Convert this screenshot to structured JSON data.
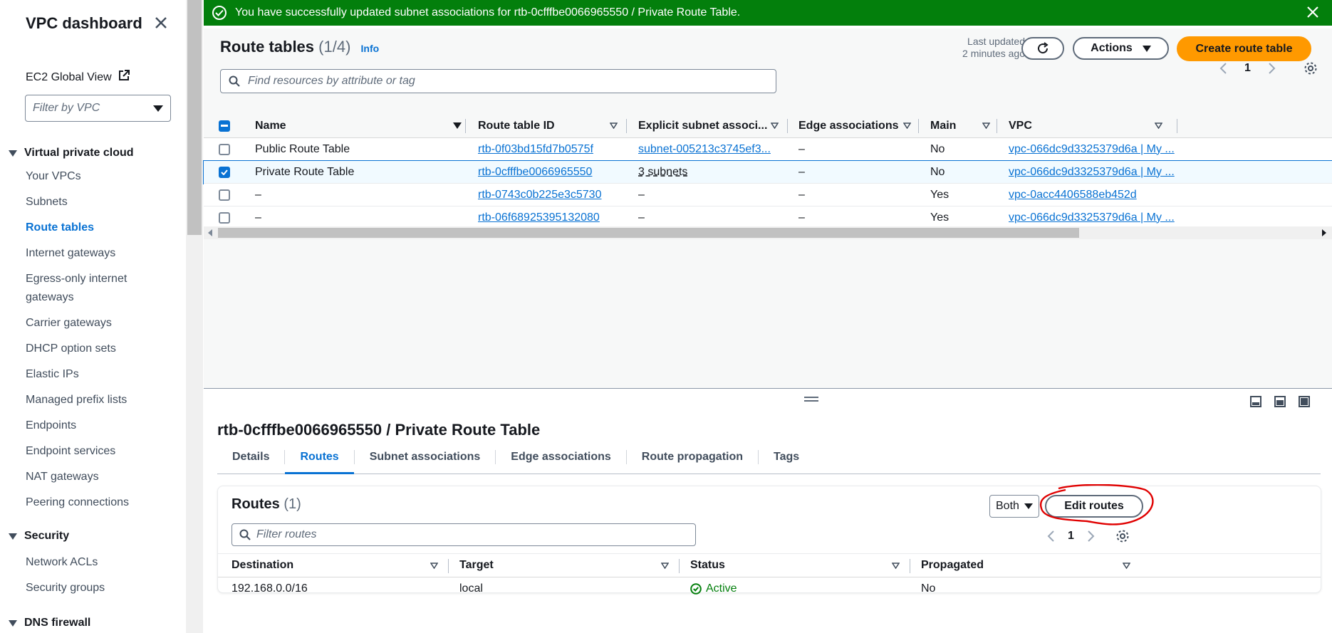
{
  "sidebar": {
    "title": "VPC dashboard",
    "global_view": "EC2 Global View",
    "vpc_filter_placeholder": "Filter by VPC",
    "sections": [
      {
        "label": "Virtual private cloud"
      },
      {
        "label": "Security"
      },
      {
        "label": "DNS firewall"
      }
    ],
    "items": [
      {
        "label": "Your VPCs"
      },
      {
        "label": "Subnets"
      },
      {
        "label": "Route tables"
      },
      {
        "label": "Internet gateways"
      },
      {
        "label": "Egress-only internet gateways"
      },
      {
        "label": "Carrier gateways"
      },
      {
        "label": "DHCP option sets"
      },
      {
        "label": "Elastic IPs"
      },
      {
        "label": "Managed prefix lists"
      },
      {
        "label": "Endpoints"
      },
      {
        "label": "Endpoint services"
      },
      {
        "label": "NAT gateways"
      },
      {
        "label": "Peering connections"
      },
      {
        "label": "Network ACLs"
      },
      {
        "label": "Security groups"
      }
    ]
  },
  "banner": {
    "message": "You have successfully updated subnet associations for rtb-0cfffbe0066965550 / Private Route Table."
  },
  "route_tables": {
    "title": "Route tables",
    "count": "(1/4)",
    "info": "Info",
    "last_updated_line1": "Last updated",
    "last_updated_line2": "2 minutes ago",
    "actions_label": "Actions",
    "create_label": "Create route table",
    "search_placeholder": "Find resources by attribute or tag",
    "page": "1",
    "columns": [
      "Name",
      "Route table ID",
      "Explicit subnet associ...",
      "Edge associations",
      "Main",
      "VPC"
    ],
    "rows": [
      {
        "name": "Public Route Table",
        "id": "rtb-0f03bd15fd7b0575f",
        "explicit": "subnet-005213c3745ef3...",
        "edge": "–",
        "main": "No",
        "vpc": "vpc-066dc9d3325379d6a | My ..."
      },
      {
        "name": "Private Route Table",
        "id": "rtb-0cfffbe0066965550",
        "explicit": "3 subnets",
        "edge": "–",
        "main": "No",
        "vpc": "vpc-066dc9d3325379d6a | My ..."
      },
      {
        "name": "–",
        "id": "rtb-0743c0b225e3c5730",
        "explicit": "–",
        "edge": "–",
        "main": "Yes",
        "vpc": "vpc-0acc4406588eb452d"
      },
      {
        "name": "–",
        "id": "rtb-06f68925395132080",
        "explicit": "–",
        "edge": "–",
        "main": "Yes",
        "vpc": "vpc-066dc9d3325379d6a | My ..."
      }
    ]
  },
  "detail": {
    "title": "rtb-0cfffbe0066965550 / Private Route Table",
    "tabs": [
      "Details",
      "Routes",
      "Subnet associations",
      "Edge associations",
      "Route propagation",
      "Tags"
    ],
    "active_tab": "Routes",
    "routes": {
      "title": "Routes",
      "count": "(1)",
      "filter_value": "Both",
      "edit_label": "Edit routes",
      "search_placeholder": "Filter routes",
      "page": "1",
      "columns": [
        "Destination",
        "Target",
        "Status",
        "Propagated"
      ],
      "rows": [
        {
          "destination": "192.168.0.0/16",
          "target": "local",
          "status": "Active",
          "propagated": "No"
        }
      ]
    }
  },
  "colors": {
    "banner_bg": "#037f0c",
    "primary_btn": "#ff9900",
    "link": "#0972d3",
    "annotation_circle": "#e00000"
  }
}
